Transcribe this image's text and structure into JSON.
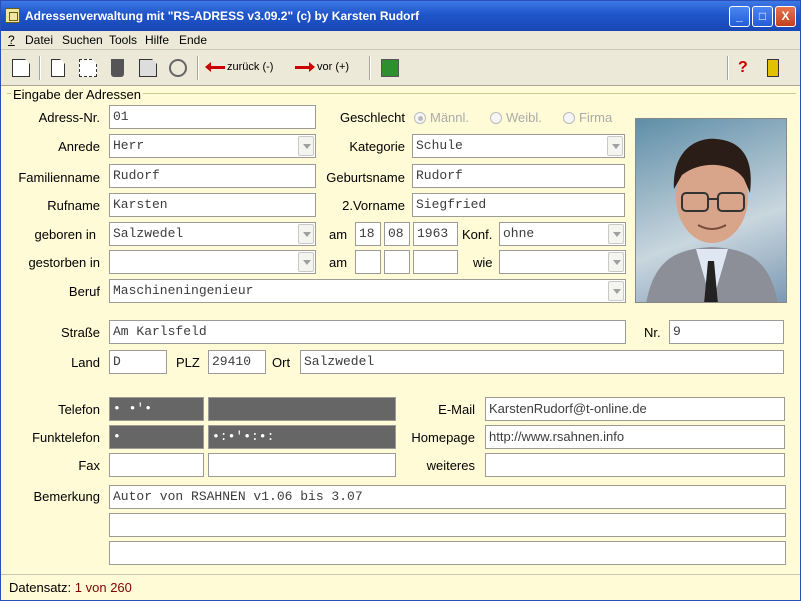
{
  "window": {
    "title": "Adressenverwaltung mit \"RS-ADRESS v3.09.2\" (c) by Karsten Rudorf",
    "min": "_",
    "max": "□",
    "close": "X"
  },
  "menu": [
    "?",
    "Datei",
    "Suchen",
    "Tools",
    "Hilfe",
    "Ende"
  ],
  "toolbar": {
    "back_label": "zurück (-)",
    "forward_label": "vor (+)",
    "help": "?"
  },
  "group_title": "Eingabe der Adressen",
  "labels": {
    "adress_nr": "Adress-Nr.",
    "anrede": "Anrede",
    "familienname": "Familienname",
    "rufname": "Rufname",
    "geboren_in": "geboren in",
    "gestorben_in": "gestorben in",
    "beruf": "Beruf",
    "geschlecht": "Geschlecht",
    "kategorie": "Kategorie",
    "geburtsname": "Geburtsname",
    "vorname2": "2.Vorname",
    "am1": "am",
    "am2": "am",
    "konf": "Konf.",
    "wie": "wie",
    "strasse": "Straße",
    "nr": "Nr.",
    "land": "Land",
    "plz": "PLZ",
    "ort": "Ort",
    "telefon": "Telefon",
    "funktelefon": "Funktelefon",
    "fax": "Fax",
    "bemerkung": "Bemerkung",
    "email": "E-Mail",
    "homepage": "Homepage",
    "weiteres": "weiteres"
  },
  "radio": {
    "m": "Männl.",
    "w": "Weibl.",
    "f": "Firma"
  },
  "values": {
    "adress_nr": "01",
    "anrede": "Herr",
    "familienname": "Rudorf",
    "rufname": "Karsten",
    "geboren_in": "Salzwedel",
    "gestorben_in": "",
    "beruf": "Maschineningenieur",
    "kategorie": "Schule",
    "geburtsname": "Rudorf",
    "vorname2": "Siegfried",
    "geb_tag": "18",
    "geb_monat": "08",
    "geb_jahr": "1963",
    "konf": "ohne",
    "tod_tag": "",
    "tod_monat": "",
    "tod_jahr": "",
    "wie": "",
    "strasse": "Am Karlsfeld",
    "nr": "9",
    "land": "D",
    "plz": "29410",
    "ort": "Salzwedel",
    "telefon_vorwahl": "• •'•",
    "telefon_nummer": "",
    "funk_vorwahl": "•",
    "funk_nummer": "•:•'•:•:",
    "fax_vorwahl": "",
    "fax_nummer": "",
    "email": "KarstenRudorf@t-online.de",
    "homepage": "http://www.rsahnen.info",
    "weiteres": "",
    "bemerkung1": "Autor von RSAHNEN v1.06 bis 3.07",
    "bemerkung2": "",
    "bemerkung3": ""
  },
  "status": {
    "label": "Datensatz:",
    "value": "1 von 260"
  }
}
